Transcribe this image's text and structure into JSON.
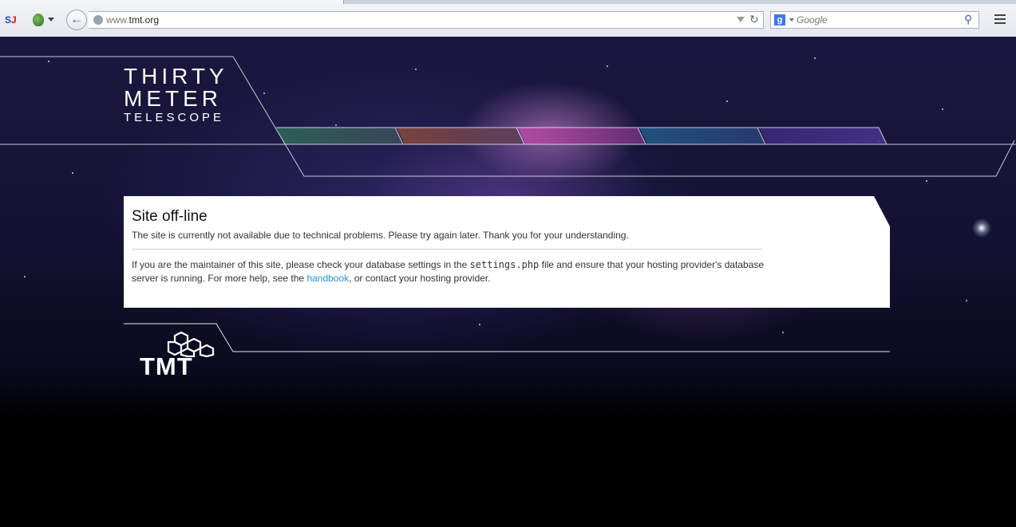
{
  "browser": {
    "address": {
      "prefix": "www.",
      "domain": "tmt.org"
    },
    "search": {
      "placeholder": "Google"
    },
    "icons": {
      "si": "si-addon-icon",
      "onion": "onion-icon",
      "back": "back-arrow-icon",
      "globe": "globe-icon",
      "reload": "reload-icon",
      "search_engine": "google-icon",
      "search_go": "magnifier-icon",
      "menu": "hamburger-menu-icon"
    }
  },
  "site": {
    "logo": {
      "line1": "THIRTY",
      "line2": "METER",
      "line3": "TELESCOPE"
    },
    "footer_logo": "TMT"
  },
  "message": {
    "title": "Site off-line",
    "line1": "The site is currently not available due to technical problems. Please try again later. Thank you for your understanding.",
    "line2_part1": "If you are the maintainer of this site, please check your database settings in the ",
    "line2_code": "settings.php",
    "line2_part2": " file and ensure that your hosting provider's database server is running. For more help, see the ",
    "line2_link": "handbook",
    "line2_part3": ", or contact your hosting provider."
  },
  "colors": {
    "link": "#2a8fd4",
    "page_bg": "#000000"
  }
}
